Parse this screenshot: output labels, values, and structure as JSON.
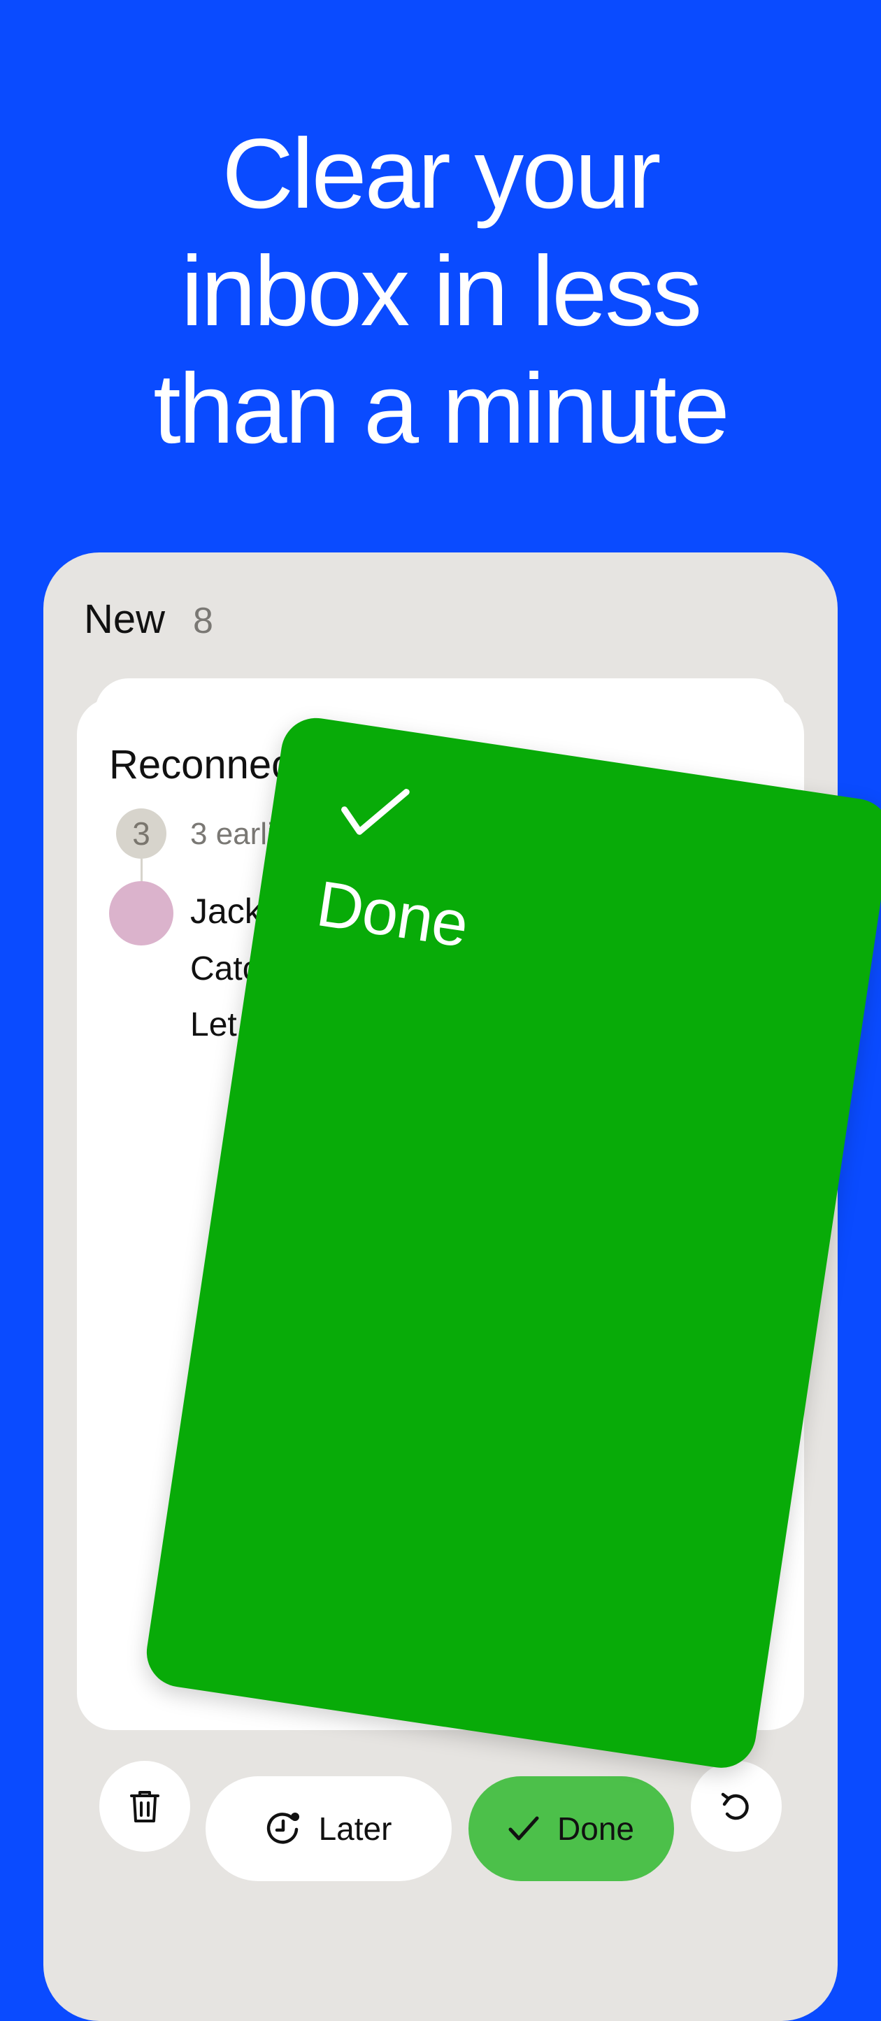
{
  "headline": {
    "line1": "Clear your",
    "line2": "inbox in less",
    "line3": "than a minute"
  },
  "inbox": {
    "section_title": "New",
    "section_count": "8"
  },
  "email": {
    "subject": "Reconnect o",
    "thread_count": "3",
    "earlier_text": "3 earlier en",
    "sender": "Jacky",
    "body_line1": "Catching",
    "body_line2": "Let me l"
  },
  "swipe_card": {
    "label": "Done",
    "icon": "checkmark-icon",
    "color": "#08ab08"
  },
  "actions": {
    "trash_icon": "trash-icon",
    "later_label": "Later",
    "later_icon": "clock-snooze-icon",
    "done_label": "Done",
    "done_icon": "checkmark-icon",
    "undo_icon": "undo-icon"
  },
  "colors": {
    "background": "#0a4bff",
    "panel": "#e6e4e1",
    "done_button": "#4cc04a",
    "avatar": "#dbb3cc"
  }
}
